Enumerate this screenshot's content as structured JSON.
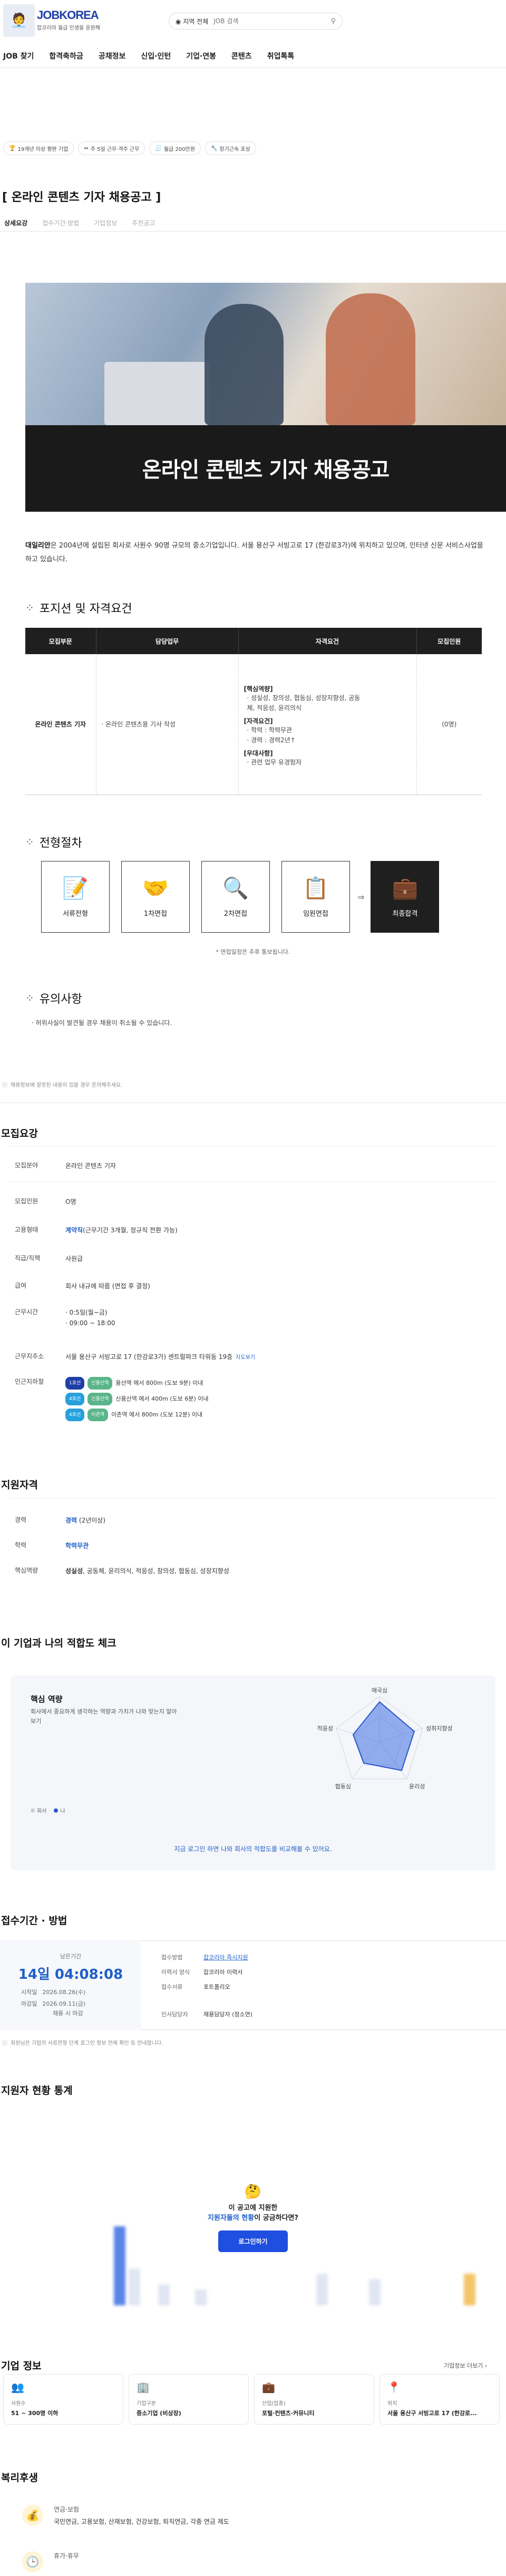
{
  "header": {
    "logo_text": "JOBKOREA",
    "logo_sub": "잡코리아 월급 인생을 응원해",
    "search_location": "◉ 지역 전체",
    "search_placeholder": "JOB 검색"
  },
  "nav": [
    "JOB 찾기",
    "합격축하금",
    "공채정보",
    "신입·인턴",
    "기업·연봉",
    "콘텐츠",
    "취업톡톡"
  ],
  "chips": [
    {
      "icon": "🏆",
      "label": "19개년 이상 평판 기업"
    },
    {
      "icon": "⇔",
      "label": "주 5일 근무·격주 근무"
    },
    {
      "icon": "🧾",
      "label": "월급 200만원"
    },
    {
      "icon": "🔧",
      "label": "장기근속 포상"
    }
  ],
  "post": {
    "title": "[ 온라인 콘텐츠 기자 채용공고 ]",
    "tabs": [
      "상세요강",
      "접수기간·방법",
      "기업정보",
      "추천공고"
    ]
  },
  "hero": {
    "title": "온라인 콘텐츠 기자 채용공고"
  },
  "intro": {
    "company": "대일리안",
    "text1": "은 2004년에 설립된 회사로 사원수 90명 규모의 중소기업입니다.  서울 용산구 서빙고로 17 (한강로3가)에 위치하고 있으며, 인터넷 신문 서비스사업을 하고 있습니다."
  },
  "position": {
    "heading": "포지션 및 자격요건",
    "columns": [
      "모집부문",
      "담당업무",
      "자격요건",
      "모집인원"
    ],
    "role": "온라인 콘텐츠 기자",
    "duty": "· 온라인 콘텐츠용 기사 작성",
    "req": [
      {
        "title": "[핵심역량]",
        "lines": [
          "· 성실성, 창의성, 협동심, 성장지향성, 공동",
          "  체, 적응성, 윤리의식"
        ]
      },
      {
        "title": "[자격요건]",
        "lines": [
          "· 학력 : 학력무관",
          "· 경력 : 경력2년↑"
        ]
      },
      {
        "title": "[우대사항]",
        "lines": [
          "· 관련 업무 유경험자"
        ]
      }
    ],
    "count": "(0명)"
  },
  "process": {
    "heading": "전형절차",
    "steps": [
      {
        "icon": "📝",
        "label": "서류전형"
      },
      {
        "icon": "🤝",
        "label": "1차면접"
      },
      {
        "icon": "🔍",
        "label": "2차면접"
      },
      {
        "icon": "📋",
        "label": "임원면접"
      },
      {
        "icon": "💼",
        "label": "최종합격"
      }
    ],
    "note": "* 면접일정은 추후 통보됩니다."
  },
  "caution": {
    "heading": "유의사항",
    "text": "· 허위사실이 발견될 경우 채용이 취소될 수 있습니다."
  },
  "notice": "채용정보에 잘못된 내용이 있을 경우 문의해주세요.",
  "recruit": {
    "heading": "모집요강",
    "rows": [
      {
        "k": "모집분야",
        "v": "온라인 콘텐츠 기자"
      },
      {
        "k": "모집인원",
        "v": "O명"
      },
      {
        "k": "고용형태",
        "v_bold": "계약직",
        "v": "(근무기간 3개월, 정규직 전환 가능)"
      },
      {
        "k": "직급/직책",
        "v": "사원급"
      },
      {
        "k": "급여",
        "v": "회사 내규에 따름 (면접 후 결정)"
      },
      {
        "k": "근무시간",
        "v": "· 0:5일(월~금)",
        "v2": "· 09:00 ~ 18:00"
      },
      {
        "k": "근무지주소",
        "v": "서울 용산구 서빙고로 17 (한강로3가) 센트럴파크 타워동 19층",
        "link": "지도보기"
      }
    ],
    "subway_label": "인근지하철",
    "subway": [
      {
        "line": "1호선",
        "color": "#1f3fa8",
        "station": "신용산역",
        "text": "용산역 에서 800m (도보 9분) 이내"
      },
      {
        "line": "4호선",
        "color": "#27a0dc",
        "station": "신용산역",
        "text": "신용산역 에서 400m (도보 6분) 이내"
      },
      {
        "line": "4호선",
        "color": "#27a0dc",
        "station": "이촌역",
        "text": "이촌역 에서 800m (도보 12분) 이내"
      }
    ]
  },
  "qual": {
    "heading": "지원자격",
    "rows": [
      {
        "k": "경력",
        "v": "경력",
        "v_rest": " (2년이상)"
      },
      {
        "k": "학력",
        "v": "학력무관",
        "v_rest": ""
      },
      {
        "k": "핵심역량",
        "v": "성실성",
        "v_rest": ", 공동체, 윤리의식, 적응성, 창의성, 협동심, 성장지향성"
      }
    ]
  },
  "fit": {
    "heading": "이 기업과 나의 적합도 체크",
    "box_title": "핵심 역량",
    "box_desc": "회사에서 중요하게 생각하는 역량과 가치가 나와 맞는지 알아보기",
    "axes": [
      "애국심",
      "성취지향성",
      "윤리성",
      "협동심",
      "적응성"
    ],
    "legend": [
      "회사",
      "나"
    ],
    "link": "지금 로그인 하면 나와 회사의 적합도를 비교해볼 수 있어요."
  },
  "deadline": {
    "heading": "접수기간 · 방법",
    "remain_label": "남은기간",
    "remain": "14일 04:08:08",
    "start_k": "시작일",
    "start_v": "2026.08.26(수)",
    "end_k": "마감일",
    "end_v": "2026.09.11(금)",
    "close_note": "채용 시 마감",
    "rows": [
      {
        "k": "접수방법",
        "v": "잡코리아 즉시지원",
        "style": "link"
      },
      {
        "k": "이력서 양식",
        "v": "잡코리아 이력서",
        "style": ""
      },
      {
        "k": "접수서류",
        "v": "포트폴리오",
        "style": ""
      },
      {
        "k": "인사담당자",
        "v": "채용담당자 (정소연)",
        "style": ""
      }
    ],
    "notice": "회원님은 기업의 서류전형 단계 로그인 정보 전체 확인 등 안내합니다."
  },
  "stats": {
    "heading": "지원자 현황 통계",
    "emoji": "🤔",
    "q1": "이 공고에 지원한",
    "q2_blue": "지원자들의 현황",
    "q2_rest": "이 궁금하다면?",
    "button": "로그인하기"
  },
  "corp": {
    "heading": "기업 정보",
    "more": "기업정보 더보기 ›",
    "cards": [
      {
        "icon": "👥",
        "k": "사원수",
        "v": "51 ~ 300명 이하"
      },
      {
        "icon": "🏢",
        "k": "기업구분",
        "v": "중소기업 (비상장)"
      },
      {
        "icon": "💼",
        "k": "산업(업종)",
        "v": "포털·컨텐츠·커뮤니티"
      },
      {
        "icon": "📍",
        "k": "위치",
        "v": "서울 용산구 서빙고로 17 (한강로..."
      }
    ]
  },
  "welfare": {
    "heading": "복리후생",
    "items": [
      {
        "icon": "💰",
        "k": "연금·보험",
        "v": "국민연금, 고용보험, 산재보험, 건강보험, 퇴직연금, 각종 연금 제도"
      },
      {
        "icon": "🕒",
        "k": "휴가·휴무",
        "v": ""
      }
    ]
  }
}
